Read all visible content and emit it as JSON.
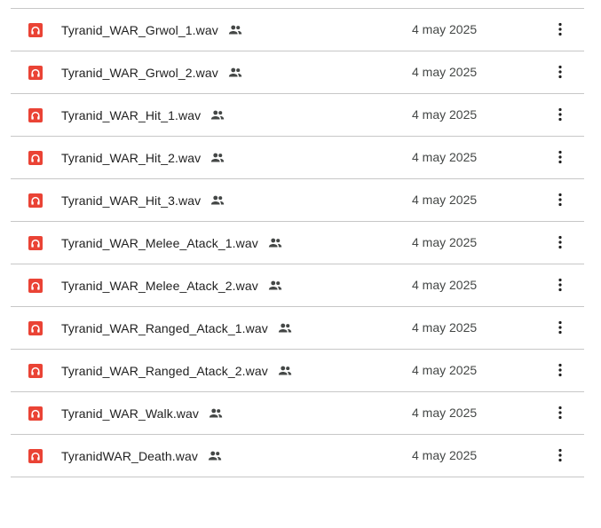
{
  "colors": {
    "audio_icon_bg": "#ea4335",
    "text_primary": "#1f1f1f",
    "text_secondary": "#444746",
    "divider": "#c7c7c7"
  },
  "icons": {
    "file_type": "audio-headphones-icon",
    "shared": "people-shared-icon",
    "more": "more-vert-icon"
  },
  "files": [
    {
      "name": "Tyranid_WAR_Grwol_1.wav",
      "date": "4 may 2025"
    },
    {
      "name": "Tyranid_WAR_Grwol_2.wav",
      "date": "4 may 2025"
    },
    {
      "name": "Tyranid_WAR_Hit_1.wav",
      "date": "4 may 2025"
    },
    {
      "name": "Tyranid_WAR_Hit_2.wav",
      "date": "4 may 2025"
    },
    {
      "name": "Tyranid_WAR_Hit_3.wav",
      "date": "4 may 2025"
    },
    {
      "name": "Tyranid_WAR_Melee_Atack_1.wav",
      "date": "4 may 2025"
    },
    {
      "name": "Tyranid_WAR_Melee_Atack_2.wav",
      "date": "4 may 2025"
    },
    {
      "name": "Tyranid_WAR_Ranged_Atack_1.wav",
      "date": "4 may 2025"
    },
    {
      "name": "Tyranid_WAR_Ranged_Atack_2.wav",
      "date": "4 may 2025"
    },
    {
      "name": "Tyranid_WAR_Walk.wav",
      "date": "4 may 2025"
    },
    {
      "name": "TyranidWAR_Death.wav",
      "date": "4 may 2025"
    }
  ]
}
